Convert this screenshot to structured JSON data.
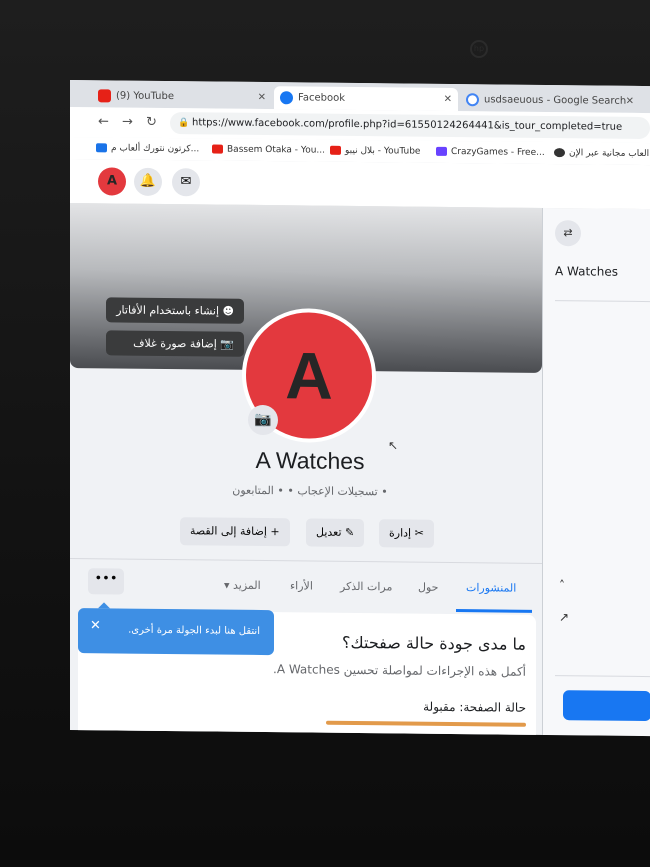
{
  "browser": {
    "tabs": [
      {
        "label": "(9) YouTube",
        "icon": "youtube-icon",
        "color": "#e62117"
      },
      {
        "label": "Facebook",
        "icon": "facebook-icon",
        "color": "#1877f2"
      },
      {
        "label": "usdsaeuous - Google Search",
        "icon": "google-icon",
        "color": "#4285f4"
      }
    ],
    "url": "https://www.facebook.com/profile.php?id=61550124264441&is_tour_completed=true",
    "bookmarks": [
      {
        "label": "كرتون نتورك ألعاب م...",
        "color": "#1a73e8"
      },
      {
        "label": "Bassem Otaka - You...",
        "color": "#e62117"
      },
      {
        "label": "بلال نيبو - YouTube",
        "color": "#e62117"
      },
      {
        "label": "CrazyGames - Free...",
        "color": "#6842ff"
      },
      {
        "label": "العاب مجانية عبر الإن...",
        "color": "#333333"
      }
    ]
  },
  "header": {
    "avatar_letter": "A"
  },
  "cover": {
    "avatar_button": "إنشاء باستخدام الأفاتار",
    "cover_button": "إضافة صورة غلاف"
  },
  "profile": {
    "avatar_letter": "A",
    "name": "A Watches",
    "stats": "• تسجيلات الإعجاب • • المتابعون",
    "buttons": {
      "manage": "إدارة",
      "edit": "تعديل",
      "add_story": "إضافة إلى القصة"
    }
  },
  "nav_tabs": [
    "المنشورات",
    "حول",
    "مرات الذكر",
    "الأراء",
    "المزيد"
  ],
  "more_dots": "•••",
  "card": {
    "title": "ما مدى جودة حالة صفحتك؟",
    "subtitle": "أكمل هذه الإجراءات لمواصلة تحسين A Watches.",
    "status": "حالة الصفحة: مقبولة"
  },
  "tooltip": {
    "text": "انتقل هنا لبدء الجولة مرة أخرى."
  },
  "right_panel": {
    "name": "A Watches"
  },
  "colors": {
    "facebook_blue": "#1877f2",
    "avatar_red": "#e3393e",
    "status_orange": "#e29a4b"
  }
}
